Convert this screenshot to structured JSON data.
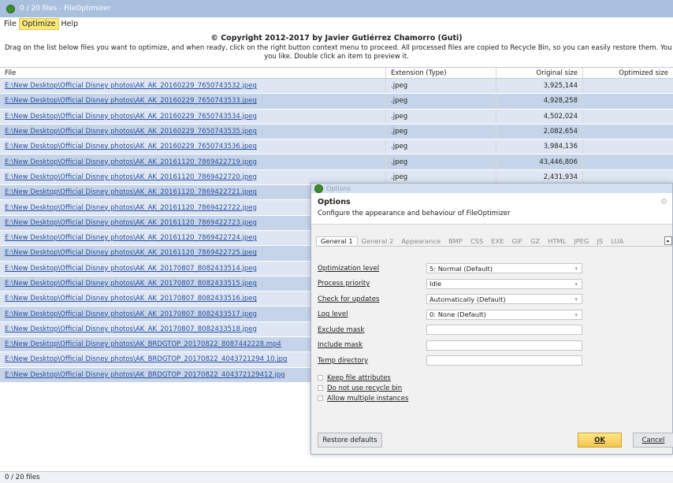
{
  "window": {
    "title": "0 / 20 files - FileOptimizer"
  },
  "menu": [
    "File",
    "Optimize",
    "Help"
  ],
  "copyright": "© Copyright 2012-2017 by Javier Gutiérrez Chamorro (Guti)",
  "instructions": {
    "line1": "Drag on the list below files you want to optimize, and when ready, click on the right button context menu to proceed. All processed files are copied to Recycle Bin, so you can easily restore them. You can disa",
    "line2": "you like. Double click an item to preview it."
  },
  "table": {
    "columns": [
      "File",
      "Extension (Type)",
      "Original size",
      "Optimized size"
    ],
    "rows": [
      [
        "E:\\New Desktop\\Official Disney photos\\AK_AK_20160229_7650743532.jpeg",
        ".jpeg",
        "3,925,144",
        ""
      ],
      [
        "E:\\New Desktop\\Official Disney photos\\AK_AK_20160229_7650743533.jpeg",
        ".jpeg",
        "4,928,258",
        ""
      ],
      [
        "E:\\New Desktop\\Official Disney photos\\AK_AK_20160229_7650743534.jpeg",
        ".jpeg",
        "4,502,024",
        ""
      ],
      [
        "E:\\New Desktop\\Official Disney photos\\AK_AK_20160229_7650743535.jpeg",
        ".jpeg",
        "2,082,654",
        ""
      ],
      [
        "E:\\New Desktop\\Official Disney photos\\AK_AK_20160229_7650743536.jpeg",
        ".jpeg",
        "3,984,136",
        ""
      ],
      [
        "E:\\New Desktop\\Official Disney photos\\AK_AK_20161120_7869422719.jpeg",
        ".jpeg",
        "43,446,806",
        ""
      ],
      [
        "E:\\New Desktop\\Official Disney photos\\AK_AK_20161120_7869422720.jpeg",
        ".jpeg",
        "2,431,934",
        ""
      ],
      [
        "E:\\New Desktop\\Official Disney photos\\AK_AK_20161120_7869422721.jpeg",
        "",
        "",
        ""
      ],
      [
        "E:\\New Desktop\\Official Disney photos\\AK_AK_20161120_7869422722.jpeg",
        "",
        "",
        ""
      ],
      [
        "E:\\New Desktop\\Official Disney photos\\AK_AK_20161120_7869422723.jpeg",
        "",
        "",
        ""
      ],
      [
        "E:\\New Desktop\\Official Disney photos\\AK_AK_20161120_7869422724.jpeg",
        "",
        "",
        ""
      ],
      [
        "E:\\New Desktop\\Official Disney photos\\AK_AK_20161120_7869422725.jpeg",
        "",
        "",
        ""
      ],
      [
        "E:\\New Desktop\\Official Disney photos\\AK_AK_20170807_8082433514.jpeg",
        "",
        "",
        ""
      ],
      [
        "E:\\New Desktop\\Official Disney photos\\AK_AK_20170807_8082433515.jpeg",
        "",
        "",
        ""
      ],
      [
        "E:\\New Desktop\\Official Disney photos\\AK_AK_20170807_8082433516.jpeg",
        "",
        "",
        ""
      ],
      [
        "E:\\New Desktop\\Official Disney photos\\AK_AK_20170807_8082433517.jpeg",
        "",
        "",
        ""
      ],
      [
        "E:\\New Desktop\\Official Disney photos\\AK_AK_20170807_8082433518.jpeg",
        "",
        "",
        ""
      ],
      [
        "E:\\New Desktop\\Official Disney photos\\AK_BRDGTOP_20170822_8087442228.mp4",
        "",
        "",
        ""
      ],
      [
        "E:\\New Desktop\\Official Disney photos\\AK_BRDGTOP_20170822_4043721294 10.jpg",
        "",
        "",
        ""
      ],
      [
        "E:\\New Desktop\\Official Disney photos\\AK_BRDGTOP_20170822_404372129412.jpg",
        "",
        "",
        ""
      ]
    ]
  },
  "status": "0 / 20 files",
  "dialog": {
    "title": "Options",
    "heading": "Options",
    "subheading": "Configure the appearance and behaviour of FileOptimizer",
    "tabs": [
      "General 1",
      "General 2",
      "Appearance",
      "BMP",
      "CSS",
      "EXE",
      "GIF",
      "GZ",
      "HTML",
      "JPEG",
      "JS",
      "LUA"
    ],
    "fields": [
      {
        "label": "Optimization level",
        "value": "5: Normal (Default)",
        "dropdown": true
      },
      {
        "label": "Process priority",
        "value": "Idle",
        "dropdown": true
      },
      {
        "label": "Check for updates",
        "value": "Automatically (Default)",
        "dropdown": true
      },
      {
        "label": "Log level",
        "value": "0: None (Default)",
        "dropdown": true
      },
      {
        "label": "Exclude mask",
        "value": "",
        "dropdown": false
      },
      {
        "label": "Include mask",
        "value": "",
        "dropdown": false
      },
      {
        "label": "Temp directory",
        "value": "",
        "dropdown": false
      }
    ],
    "checkboxes": [
      "Keep file attributes",
      "Do not use recycle bin",
      "Allow multiple instances"
    ],
    "restore_label": "Restore defaults",
    "ok_label": "OK",
    "cancel_label": "Cancel"
  }
}
